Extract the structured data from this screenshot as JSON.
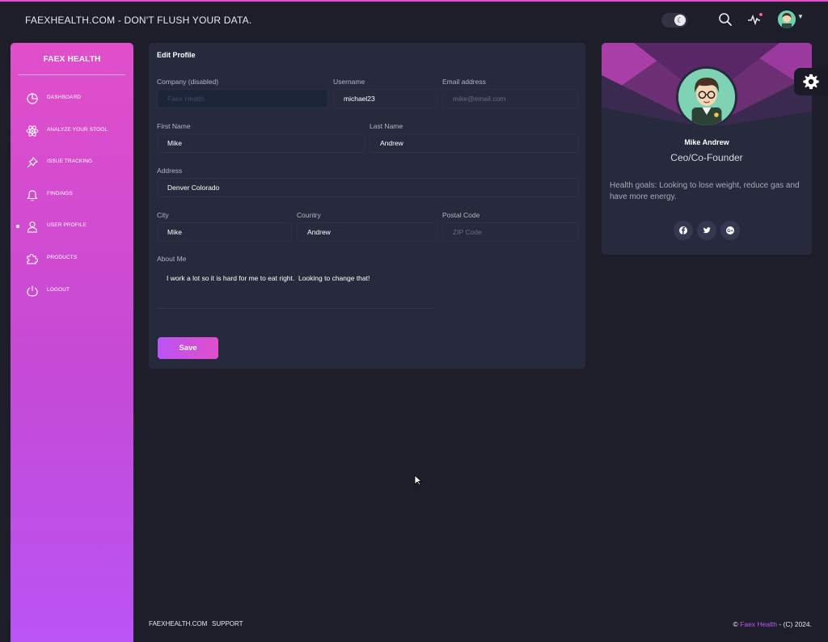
{
  "navbar": {
    "brand": "FAEXHEALTH.COM - DON'T FLUSH YOUR DATA."
  },
  "sidebar": {
    "title": "FAEX HEALTH",
    "items": [
      {
        "label": "DASHBOARD",
        "icon": "chart-pie-icon"
      },
      {
        "label": "ANALYZE YOUR STOOL",
        "icon": "atom-icon"
      },
      {
        "label": "ISSUE TRACKING",
        "icon": "pin-icon"
      },
      {
        "label": "FINDINGS",
        "icon": "bell-icon"
      },
      {
        "label": "USER PROFILE",
        "icon": "user-icon",
        "active": true
      },
      {
        "label": "PRODUCTS",
        "icon": "puzzle-icon"
      },
      {
        "label": "LOGOUT",
        "icon": "power-icon"
      }
    ]
  },
  "edit_profile": {
    "title": "Edit Profile",
    "company": {
      "label": "Company (disabled)",
      "value": "Faex Health"
    },
    "username": {
      "label": "Username",
      "value": "michael23"
    },
    "email": {
      "label": "Email address",
      "placeholder": "mike@email.com"
    },
    "first_name": {
      "label": "First Name",
      "value": "Mike"
    },
    "last_name": {
      "label": "Last Name",
      "value": "Andrew"
    },
    "address": {
      "label": "Address",
      "value": "Denver Colorado"
    },
    "city": {
      "label": "City",
      "value": "Mike"
    },
    "country": {
      "label": "Country",
      "value": "Andrew"
    },
    "postal": {
      "label": "Postal Code",
      "placeholder": "ZIP Code"
    },
    "about": {
      "label": "About Me",
      "value": "I work a lot so it is hard for me to eat right.  Looking to change that!"
    },
    "save_label": "Save"
  },
  "user_card": {
    "name": "Mike Andrew",
    "role": "Ceo/Co-Founder",
    "description": "Health goals: Looking to lose weight, reduce gas and have more energy.",
    "socials": [
      "facebook-icon",
      "twitter-icon",
      "google-plus-icon"
    ]
  },
  "footer": {
    "link1": "FAEXHEALTH.COM",
    "link2": "SUPPORT",
    "copyright_prefix": "©",
    "copyright_brand": "Faex Health",
    "copyright_suffix": "- (C) 2024."
  },
  "colors": {
    "accent_pink": "#e14eca",
    "accent_purple": "#ba54f5",
    "background": "#1e1e2a",
    "card": "#27293d"
  }
}
